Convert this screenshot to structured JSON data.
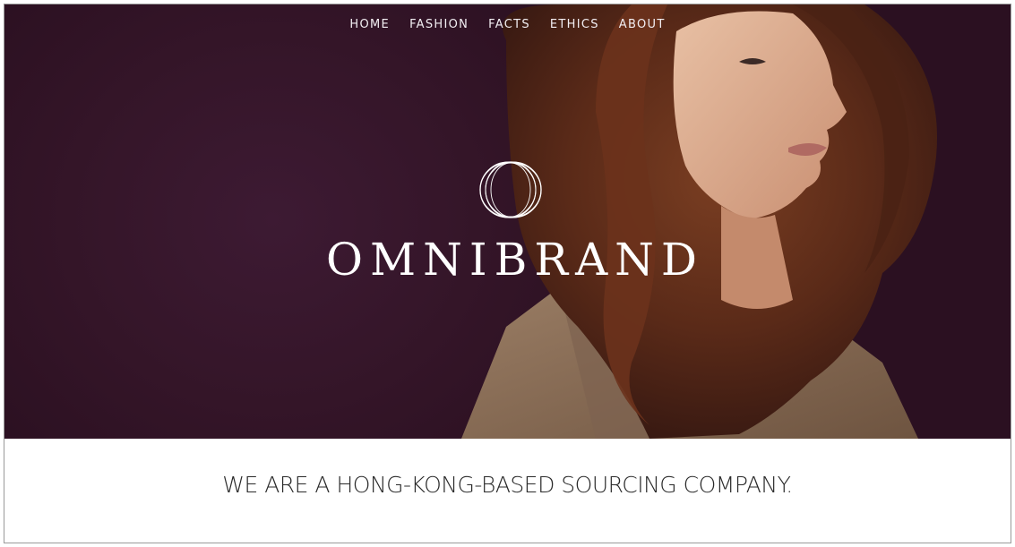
{
  "nav": {
    "items": [
      {
        "label": "HOME"
      },
      {
        "label": "FASHION"
      },
      {
        "label": "FACTS"
      },
      {
        "label": "ETHICS"
      },
      {
        "label": "ABOUT"
      }
    ]
  },
  "hero": {
    "brand_name": "OMNIBRAND",
    "logo_icon": "interlocking-rings-icon"
  },
  "tagline": "WE ARE A HONG-KONG-BASED SOURCING COMPANY.",
  "colors": {
    "hero_background": "#341528",
    "text_light": "#ffffff",
    "text_dark": "#2a2a2a"
  }
}
